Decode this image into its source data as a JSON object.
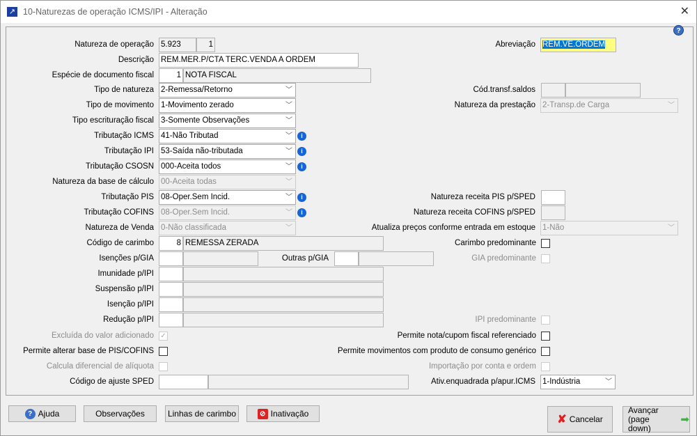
{
  "window": {
    "title": "10-Naturezas de operação ICMS/IPI - Alteração",
    "close_glyph": "✕"
  },
  "form": {
    "natureza_operacao": {
      "label": "Natureza de operação",
      "code": "5.923",
      "seq": "1"
    },
    "abreviacao": {
      "label": "Abreviação",
      "value": "REM.VE.ORDEM"
    },
    "descricao": {
      "label": "Descrição",
      "value": "REM.MER.P/CTA TERC.VENDA A ORDEM"
    },
    "especie": {
      "label": "Espécie de documento fiscal",
      "code": "1",
      "desc": "NOTA FISCAL"
    },
    "tipo_natureza": {
      "label": "Tipo de natureza",
      "value": "2-Remessa/Retorno"
    },
    "cod_transf": {
      "label": "Cód.transf.saldos",
      "code": "",
      "desc": ""
    },
    "tipo_movimento": {
      "label": "Tipo de movimento",
      "value": "1-Movimento zerado"
    },
    "natureza_prestacao": {
      "label": "Natureza da prestação",
      "value": "2-Transp.de Carga"
    },
    "tipo_escrituracao": {
      "label": "Tipo escrituração fiscal",
      "value": "3-Somente Observações"
    },
    "trib_icms": {
      "label": "Tributação ICMS",
      "value": "41-Não Tributad"
    },
    "trib_ipi": {
      "label": "Tributação IPI",
      "value": "53-Saída não-tributada"
    },
    "trib_csosn": {
      "label": "Tributação CSOSN",
      "value": "000-Aceita todos"
    },
    "nat_base_calc": {
      "label": "Natureza da base de cálculo",
      "value": "00-Aceita todas"
    },
    "trib_pis": {
      "label": "Tributação PIS",
      "value": "08-Oper.Sem Incid."
    },
    "nat_rec_pis": {
      "label": "Natureza receita PIS p/SPED",
      "value": ""
    },
    "trib_cofins": {
      "label": "Tributação COFINS",
      "value": "08-Oper.Sem Incid."
    },
    "nat_rec_cofins": {
      "label": "Natureza receita COFINS p/SPED",
      "value": ""
    },
    "nat_venda": {
      "label": "Natureza de Venda",
      "value": "0-Não classificada"
    },
    "atualiza_precos": {
      "label": "Atualiza preços conforme entrada em estoque",
      "value": "1-Não"
    },
    "cod_carimbo": {
      "label": "Código de carimbo",
      "code": "8",
      "desc": "REMESSA ZERADA"
    },
    "carimbo_pred": {
      "label": "Carimbo predominante",
      "checked": false
    },
    "isencoes_gia": {
      "label": "Isenções p/GIA",
      "code": "",
      "desc": ""
    },
    "outras_gia": {
      "label": "Outras p/GIA",
      "code": "",
      "desc": ""
    },
    "gia_pred": {
      "label": "GIA predominante",
      "checked": false
    },
    "imunidade_ipi": {
      "label": "Imunidade p/IPI",
      "code": "",
      "desc": ""
    },
    "suspensao_ipi": {
      "label": "Suspensão p/IPI",
      "code": "",
      "desc": ""
    },
    "isencao_ipi": {
      "label": "Isenção p/IPI",
      "code": "",
      "desc": ""
    },
    "reducao_ipi": {
      "label": "Redução p/IPI",
      "code": "",
      "desc": ""
    },
    "ipi_pred": {
      "label": "IPI predominante",
      "checked": false
    },
    "excluida_va": {
      "label": "Excluída do valor adicionado",
      "checked": true
    },
    "permite_nota": {
      "label": "Permite nota/cupom fiscal referenciado",
      "checked": false
    },
    "permite_alterar_pis": {
      "label": "Permite alterar base de PIS/COFINS",
      "checked": false
    },
    "permite_mov": {
      "label": "Permite movimentos com produto de consumo genérico",
      "checked": false
    },
    "calcula_dif": {
      "label": "Calcula diferencial de alíquota",
      "checked": false
    },
    "importacao": {
      "label": "Importação por conta e ordem",
      "checked": false
    },
    "cod_ajuste_sped": {
      "label": "Código de ajuste SPED",
      "code": "",
      "desc": ""
    },
    "ativ_enquadrada": {
      "label": "Ativ.enquadrada p/apur.ICMS",
      "value": "1-Indústria"
    }
  },
  "buttons": {
    "ajuda": "Ajuda",
    "observacoes": "Observações",
    "linhas": "Linhas de carimbo",
    "inativacao": "Inativação",
    "cancelar": "Cancelar",
    "avancar_1": "Avançar",
    "avancar_2": "(page down)"
  },
  "icons": {
    "info": "i",
    "help": "?",
    "check": "✓",
    "chevron": "﹀"
  }
}
